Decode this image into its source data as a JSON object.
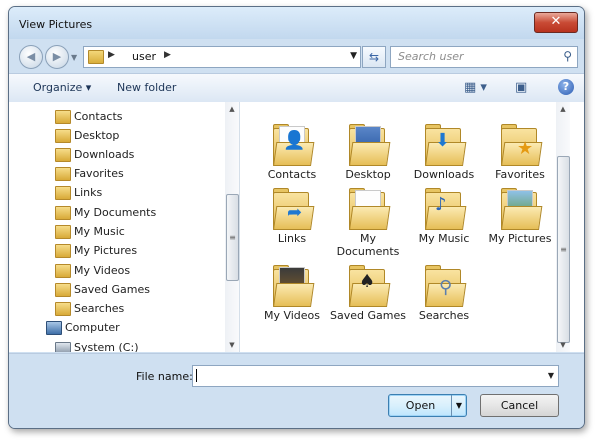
{
  "window": {
    "title": "View Pictures",
    "close": "✕"
  },
  "nav": {
    "back_icon": "back-arrow-icon",
    "forward_icon": "forward-arrow-icon",
    "address_crumb": "user",
    "search_placeholder": "Search   user"
  },
  "toolbar": {
    "organize": "Organize",
    "new_folder": "New folder"
  },
  "sidebar": {
    "items": [
      {
        "label": "Contacts"
      },
      {
        "label": "Desktop"
      },
      {
        "label": "Downloads"
      },
      {
        "label": "Favorites"
      },
      {
        "label": "Links"
      },
      {
        "label": "My Documents"
      },
      {
        "label": "My Music"
      },
      {
        "label": "My Pictures"
      },
      {
        "label": "My Videos"
      },
      {
        "label": "Saved Games"
      },
      {
        "label": "Searches"
      },
      {
        "label": "Computer"
      },
      {
        "label": "System (C:)"
      }
    ]
  },
  "files": [
    {
      "name": "Contacts",
      "icon": "contacts-folder-icon"
    },
    {
      "name": "Desktop",
      "icon": "desktop-folder-icon"
    },
    {
      "name": "Downloads",
      "icon": "downloads-folder-icon"
    },
    {
      "name": "Favorites",
      "icon": "favorites-folder-icon"
    },
    {
      "name": "Links",
      "icon": "links-folder-icon"
    },
    {
      "name": "My Documents",
      "icon": "documents-folder-icon"
    },
    {
      "name": "My Music",
      "icon": "music-folder-icon"
    },
    {
      "name": "My Pictures",
      "icon": "pictures-folder-icon"
    },
    {
      "name": "My Videos",
      "icon": "videos-folder-icon"
    },
    {
      "name": "Saved Games",
      "icon": "saved-games-folder-icon"
    },
    {
      "name": "Searches",
      "icon": "searches-folder-icon"
    }
  ],
  "footer": {
    "file_name_label": "File name:",
    "file_name_value": "",
    "open": "Open",
    "cancel": "Cancel"
  }
}
